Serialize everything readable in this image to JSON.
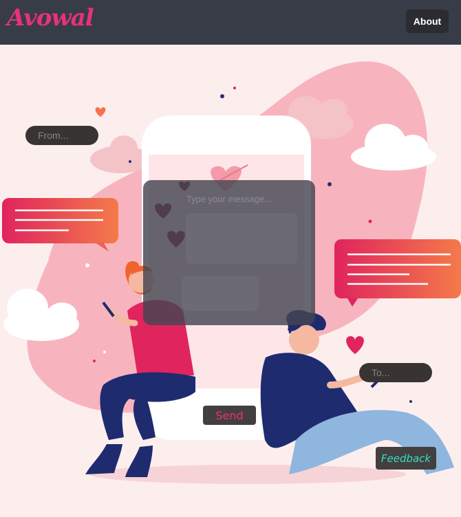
{
  "navbar": {
    "brand": "Avowal",
    "about_label": "About"
  },
  "form": {
    "from_placeholder": "From...",
    "message_placeholder": "Type your message...",
    "to_placeholder": "To...",
    "send_label": "Send",
    "feedback_label": "Feedback"
  },
  "colors": {
    "navbar_bg": "#383c47",
    "brand": "#e8317a",
    "page_bg": "#fdeeee",
    "send_text": "#e8317a",
    "feedback_text": "#2fe0c0"
  },
  "illustration": {
    "name": "two-people-texting-illustration"
  }
}
